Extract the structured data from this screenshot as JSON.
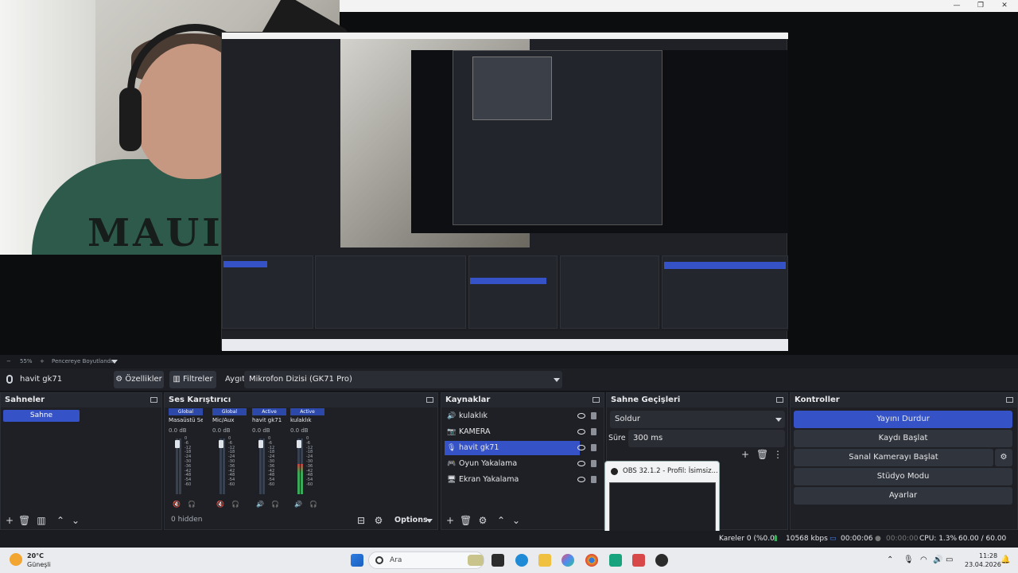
{
  "preview": {
    "window_controls": [
      "—",
      "❐",
      "✕"
    ],
    "shirt_text": "MAUI",
    "zoom_label": "55%",
    "zoom_mode": "Pencereye Boyutlandır"
  },
  "device_bar": {
    "source_name": "havit gk71",
    "properties_label": "Özellikler",
    "filters_label": "Filtreler",
    "device_label": "Aygıt",
    "device_value": "Mikrofon Dizisi (GK71 Pro)"
  },
  "scenes": {
    "title": "Sahneler",
    "items": [
      "Sahne"
    ]
  },
  "mixer": {
    "title": "Ses Karıştırıcı",
    "channels": [
      {
        "header": "Global",
        "name": "Masaüstü Ses",
        "db": "0.0 dB",
        "level": 0.0,
        "muted": true
      },
      {
        "header": "Global",
        "name": "Mic/Aux",
        "db": "0.0 dB",
        "level": 0.0,
        "muted": true
      },
      {
        "header": "Active",
        "name": "havit gk71",
        "db": "0.0 dB",
        "level": 0.0,
        "muted": false
      },
      {
        "header": "Active",
        "name": "kulaklık",
        "db": "0.0 dB",
        "level": 0.55,
        "muted": false
      }
    ],
    "ticks": [
      "0",
      "-6",
      "-12",
      "-18",
      "-24",
      "-30",
      "-36",
      "-42",
      "-48",
      "-54",
      "-60"
    ],
    "hidden_label": "0 hidden",
    "options_label": "Options"
  },
  "sources": {
    "title": "Kaynaklar",
    "items": [
      {
        "name": "kulaklık",
        "icon": "speaker-icon"
      },
      {
        "name": "KAMERA",
        "icon": "camera-icon"
      },
      {
        "name": "havit gk71",
        "icon": "microphone-icon",
        "selected": true
      },
      {
        "name": "Oyun Yakalama",
        "icon": "gamepad-icon"
      },
      {
        "name": "Ekran Yakalama",
        "icon": "monitor-icon"
      }
    ]
  },
  "transitions": {
    "title": "Sahne Geçişleri",
    "type": "Soldur",
    "duration_label": "Süre",
    "duration_value": "300 ms"
  },
  "controls": {
    "title": "Kontroller",
    "stop_stream": "Yayını Durdur",
    "start_record": "Kaydı Başlat",
    "virtual_cam": "Sanal Kamerayı Başlat",
    "studio_mode": "Stüdyo Modu",
    "settings": "Ayarlar"
  },
  "thumbnail": {
    "title": "OBS 32.1.2 - Profil: İsimsiz..."
  },
  "status": {
    "frames": "Kareler 0 (%0.0)",
    "bitrate": "10568 kbps",
    "stream_time": "00:00:06",
    "record_time": "00:00:00",
    "cpu": "CPU: 1.3%",
    "fps": "60.00 / 60.00 FPS"
  },
  "taskbar": {
    "weather_temp": "20°C",
    "weather_desc": "Güneşli",
    "search_placeholder": "Ara",
    "time": "11:28",
    "date": "23.04.2026"
  },
  "colors": {
    "accent": "#3553c6",
    "panel": "#1e2025",
    "meter_green": "#3aa95b",
    "meter_red": "#c24141"
  }
}
